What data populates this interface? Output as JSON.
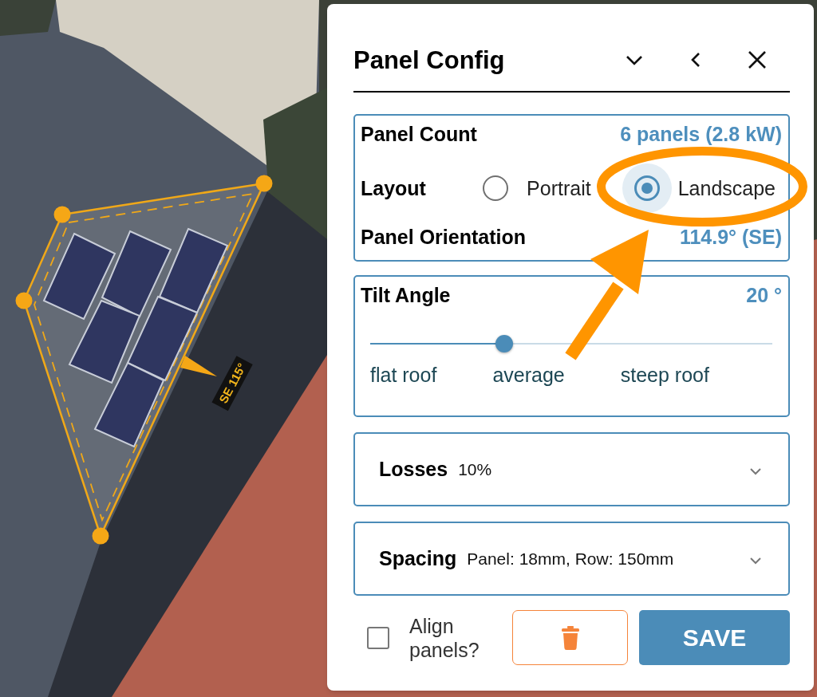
{
  "panel": {
    "title": "Panel Config"
  },
  "summary": {
    "rows": [
      {
        "kind": "value",
        "label": "Panel Count",
        "value": "6 panels (2.8 kW)"
      },
      {
        "kind": "radio",
        "label": "Layout",
        "options": [
          {
            "label": "Portrait",
            "selected": false
          },
          {
            "label": "Landscape",
            "selected": true
          }
        ]
      },
      {
        "kind": "value",
        "label": "Panel Orientation",
        "value": "114.9° (SE)"
      }
    ]
  },
  "tilt": {
    "label": "Tilt Angle",
    "value": "20 °",
    "level": 0.333,
    "ticks": [
      "flat roof",
      "average",
      "steep roof"
    ]
  },
  "sections": [
    {
      "label": "Losses",
      "summary": "10%",
      "expanded": false
    },
    {
      "label": "Spacing",
      "summary": "Panel: 18mm, Row: 150mm",
      "expanded": false
    }
  ],
  "footer": {
    "align": {
      "label": "Align panels?",
      "checked": false
    },
    "save": "SAVE"
  },
  "map": {
    "direction_label": "SE 115°"
  }
}
